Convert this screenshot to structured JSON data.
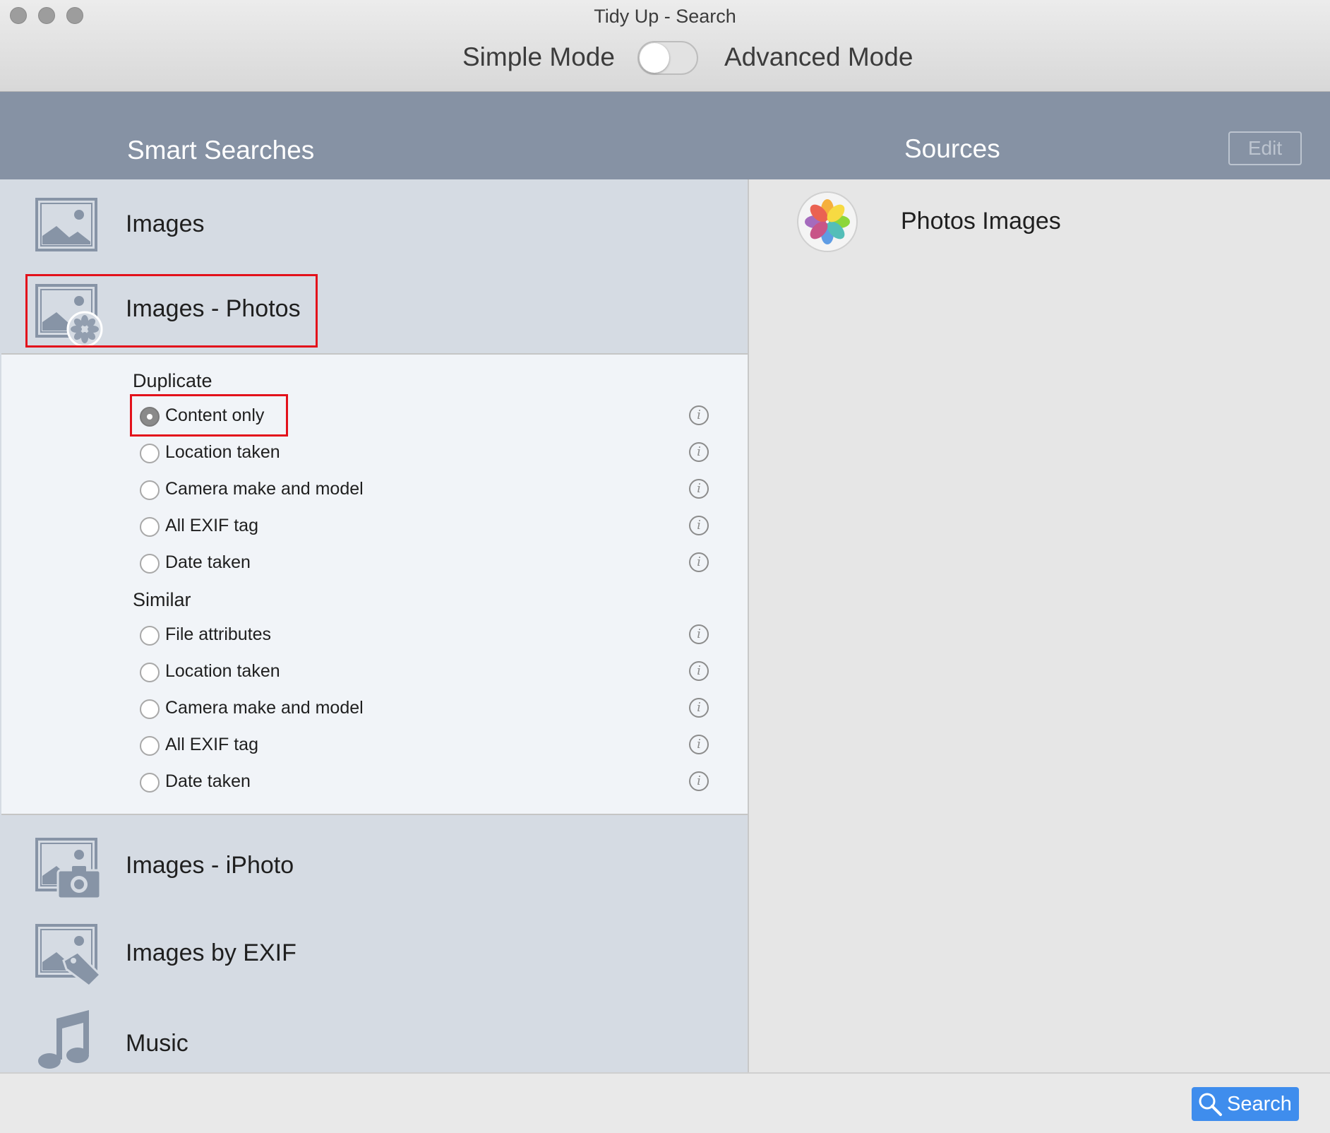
{
  "window": {
    "title": "Tidy Up - Search",
    "mode_left": "Simple Mode",
    "mode_right": "Advanced Mode",
    "advanced_mode_on": false
  },
  "header": {
    "left_title": "Smart Searches",
    "right_title": "Sources",
    "edit_label": "Edit"
  },
  "smart_searches": [
    {
      "label": "Images",
      "icon": "image-icon"
    },
    {
      "label": "Images - Photos",
      "icon": "photos-image-icon",
      "expanded": true
    },
    {
      "label": "Images - iPhoto",
      "icon": "iphoto-image-icon"
    },
    {
      "label": "Images by EXIF",
      "icon": "exif-image-icon"
    },
    {
      "label": "Music",
      "icon": "music-note-icon"
    }
  ],
  "options": {
    "duplicate_label": "Duplicate",
    "duplicate": [
      {
        "label": "Content only",
        "checked": true
      },
      {
        "label": "Location taken",
        "checked": false
      },
      {
        "label": "Camera make and model",
        "checked": false
      },
      {
        "label": "All EXIF tag",
        "checked": false
      },
      {
        "label": "Date taken",
        "checked": false
      }
    ],
    "similar_label": "Similar",
    "similar": [
      {
        "label": "File attributes",
        "checked": false
      },
      {
        "label": "Location taken",
        "checked": false
      },
      {
        "label": "Camera make and model",
        "checked": false
      },
      {
        "label": "All EXIF tag",
        "checked": false
      },
      {
        "label": "Date taken",
        "checked": false
      }
    ],
    "info_glyph": "i"
  },
  "sources": [
    {
      "label": "Photos Images",
      "icon": "photos-app-icon"
    }
  ],
  "footer": {
    "search_label": "Search"
  },
  "colors": {
    "accent_blue": "#3f8ded",
    "header_band": "#8692a4",
    "highlight_red": "#e3111b"
  }
}
